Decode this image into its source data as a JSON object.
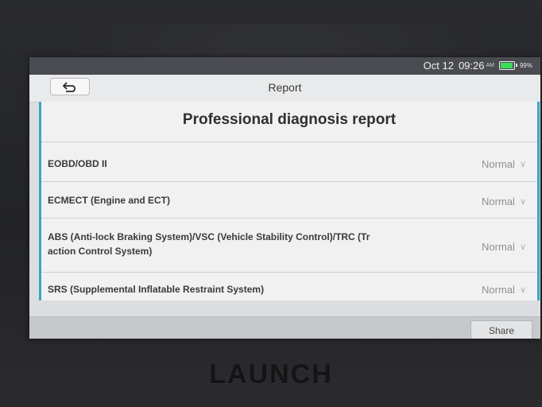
{
  "status_bar": {
    "date": "Oct 12",
    "time": "09:26",
    "ampm": "AM",
    "battery": "99%",
    "battery_color": "#3ddc5a"
  },
  "title_bar": {
    "back_icon": "back-arrow-icon",
    "title": "Report"
  },
  "report": {
    "title": "Professional diagnosis report",
    "accent_color": "#3ba4c8",
    "rows": [
      {
        "label": "EOBD/OBD II",
        "status": "Normal"
      },
      {
        "label": "ECMECT (Engine and ECT)",
        "status": "Normal"
      },
      {
        "label_line1": "ABS (Anti-lock Braking System)/VSC (Vehicle Stability Control)/TRC (Tr",
        "label_line2": "action Control System)",
        "status": "Normal"
      },
      {
        "label": "SRS (Supplemental Inflatable Restraint System)",
        "status": "Normal"
      }
    ]
  },
  "bottom_bar": {
    "share_label": "Share"
  },
  "device": {
    "brand": "LAUNCH"
  }
}
